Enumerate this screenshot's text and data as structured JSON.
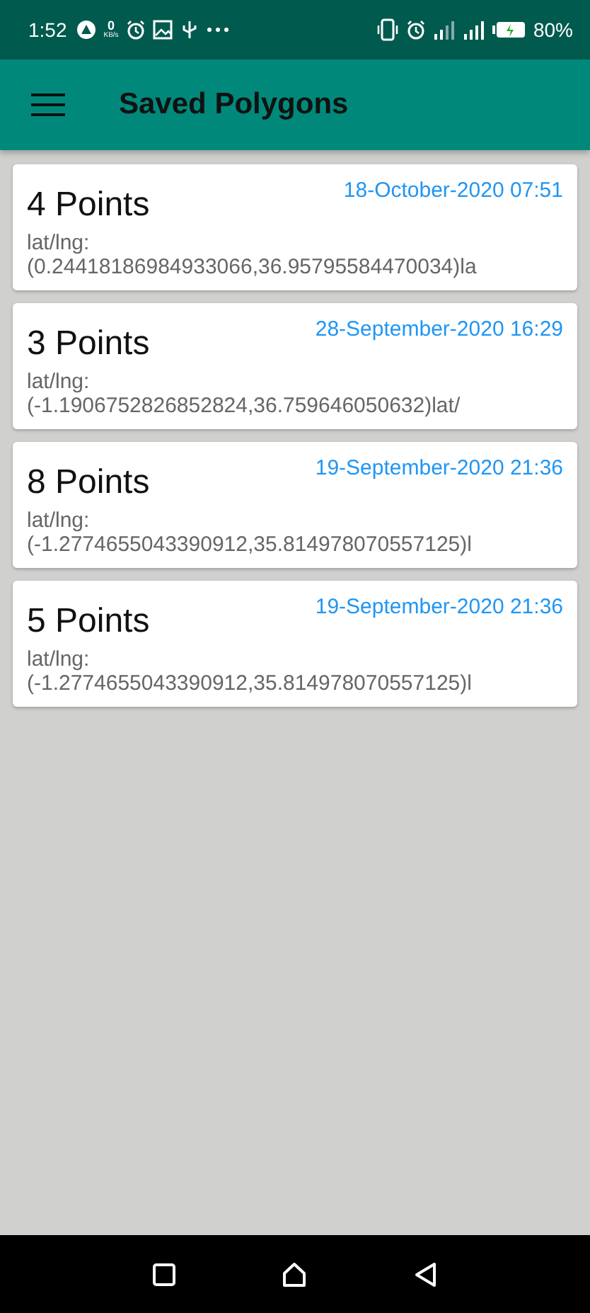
{
  "status_bar": {
    "time": "1:52",
    "net_speed_value": "0",
    "net_speed_unit": "KB/s",
    "battery": "80%"
  },
  "app_bar": {
    "title": "Saved Polygons"
  },
  "polygons": [
    {
      "points": "4 Points",
      "date": "18-October-2020 07:51",
      "label": "lat/lng:",
      "coords": "(0.24418186984933066,36.95795584470034)la"
    },
    {
      "points": "3 Points",
      "date": "28-September-2020 16:29",
      "label": "lat/lng:",
      "coords": "(-1.1906752826852824,36.759646050632)lat/"
    },
    {
      "points": "8 Points",
      "date": "19-September-2020 21:36",
      "label": "lat/lng:",
      "coords": "(-1.2774655043390912,35.814978070557125)l"
    },
    {
      "points": "5 Points",
      "date": "19-September-2020 21:36",
      "label": "lat/lng:",
      "coords": "(-1.2774655043390912,35.814978070557125)l"
    }
  ]
}
